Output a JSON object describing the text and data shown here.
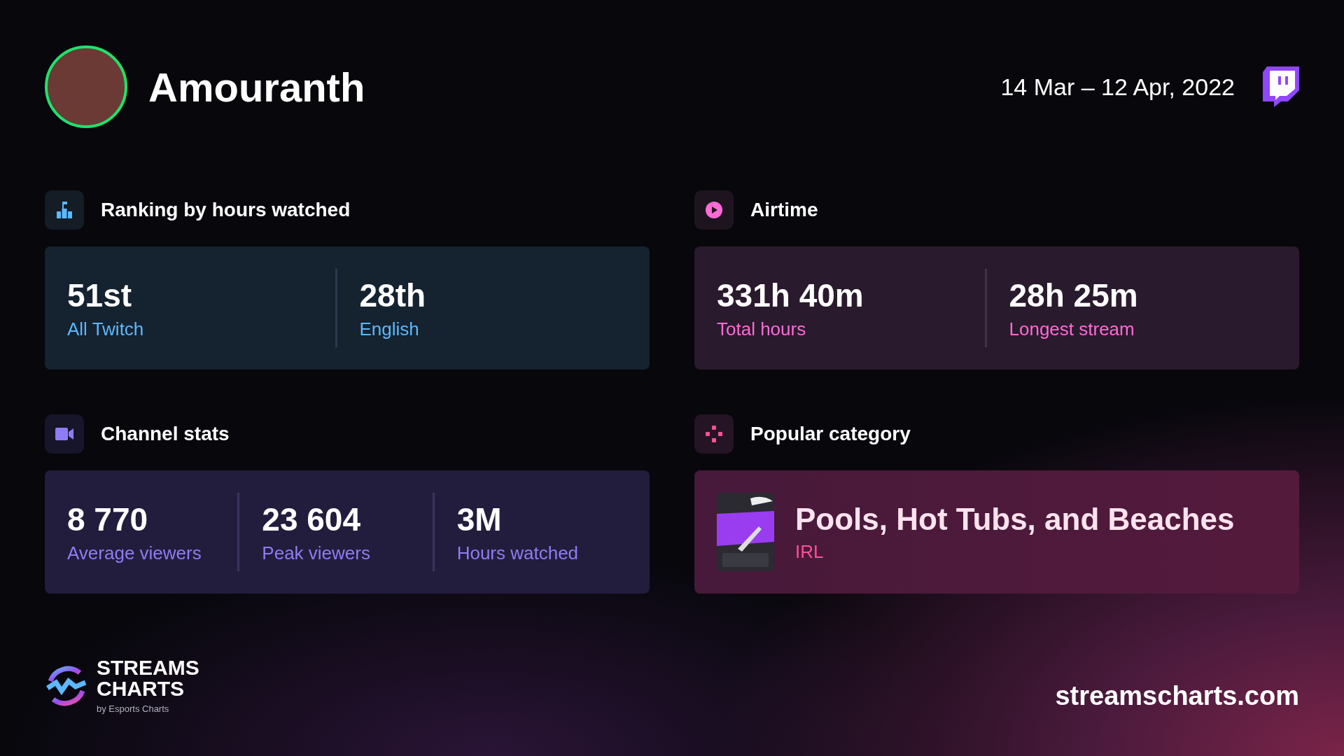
{
  "header": {
    "name": "Amouranth",
    "date_range": "14 Mar – 12 Apr, 2022"
  },
  "sections": [
    {
      "kind": "stats",
      "title": "Ranking by hours watched",
      "stats": [
        {
          "value": "51st",
          "label": "All Twitch"
        },
        {
          "value": "28th",
          "label": "English"
        }
      ]
    },
    {
      "kind": "stats",
      "title": "Airtime",
      "stats": [
        {
          "value": "331h 40m",
          "label": "Total hours"
        },
        {
          "value": "28h 25m",
          "label": "Longest stream"
        }
      ]
    },
    {
      "kind": "stats",
      "title": "Channel stats",
      "stats": [
        {
          "value": "8 770",
          "label": "Average viewers"
        },
        {
          "value": "23 604",
          "label": "Peak viewers"
        },
        {
          "value": "3M",
          "label": "Hours watched"
        }
      ]
    },
    {
      "kind": "category",
      "title": "Popular category",
      "name": "Pools, Hot Tubs, and Beaches",
      "genre": "IRL"
    }
  ],
  "footer": {
    "logo_lines": [
      "STREAMS",
      "CHARTS"
    ],
    "logo_subtitle": "by Esports Charts",
    "url": "streamscharts.com"
  }
}
